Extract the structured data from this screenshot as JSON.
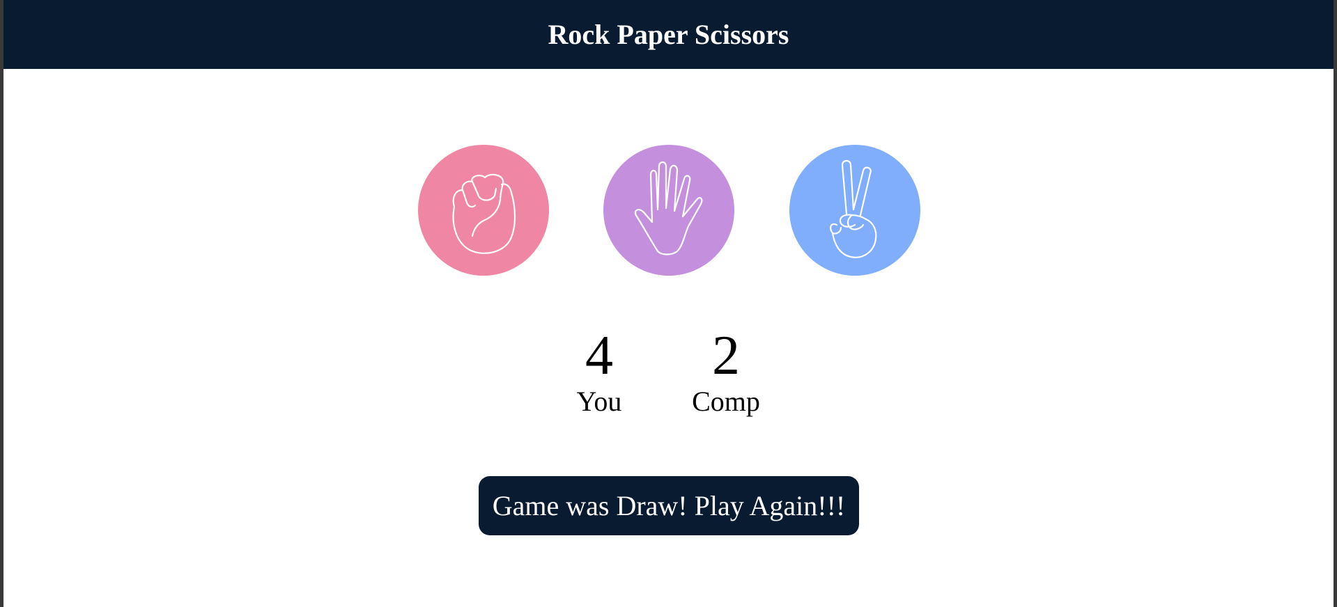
{
  "header": {
    "title": "Rock Paper Scissors"
  },
  "choices": [
    {
      "id": "rock",
      "icon": "fist-icon",
      "color": "#ef86a3"
    },
    {
      "id": "paper",
      "icon": "open-hand-icon",
      "color": "#c490de"
    },
    {
      "id": "scissors",
      "icon": "peace-hand-icon",
      "color": "#80adfc"
    }
  ],
  "scoreboard": {
    "user": {
      "score": "4",
      "label": "You"
    },
    "comp": {
      "score": "2",
      "label": "Comp"
    }
  },
  "message": {
    "text": "Game was Draw! Play Again!!!"
  },
  "colors": {
    "header_bg": "#081b31",
    "message_bg": "#081b31"
  }
}
